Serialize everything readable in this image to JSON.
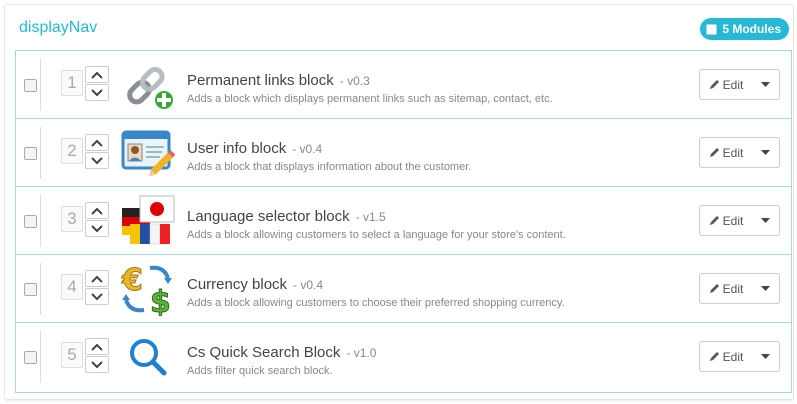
{
  "panel": {
    "title": "displayNav",
    "badge_label": "5 Modules"
  },
  "modules": [
    {
      "position": "1",
      "name": "Permanent links block",
      "version": "- v0.3",
      "description": "Adds a block which displays permanent links such as sitemap, contact, etc.",
      "icon": "chain-link-add-icon",
      "edit_label": "Edit"
    },
    {
      "position": "2",
      "name": "User info block",
      "version": "- v0.4",
      "description": "Adds a block that displays information about the customer.",
      "icon": "user-card-pencil-icon",
      "edit_label": "Edit"
    },
    {
      "position": "3",
      "name": "Language selector block",
      "version": "- v1.5",
      "description": "Adds a block allowing customers to select a language for your store's content.",
      "icon": "flags-icon",
      "edit_label": "Edit"
    },
    {
      "position": "4",
      "name": "Currency block",
      "version": "- v0.4",
      "description": "Adds a block allowing customers to choose their preferred shopping currency.",
      "icon": "euro-dollar-exchange-icon",
      "edit_label": "Edit"
    },
    {
      "position": "5",
      "name": "Cs Quick Search Block",
      "version": "- v1.0",
      "description": "Adds filter quick search block.",
      "icon": "magnifier-icon",
      "edit_label": "Edit"
    }
  ],
  "colors": {
    "accent": "#25b9d7",
    "row_border": "#a7d7e7"
  }
}
